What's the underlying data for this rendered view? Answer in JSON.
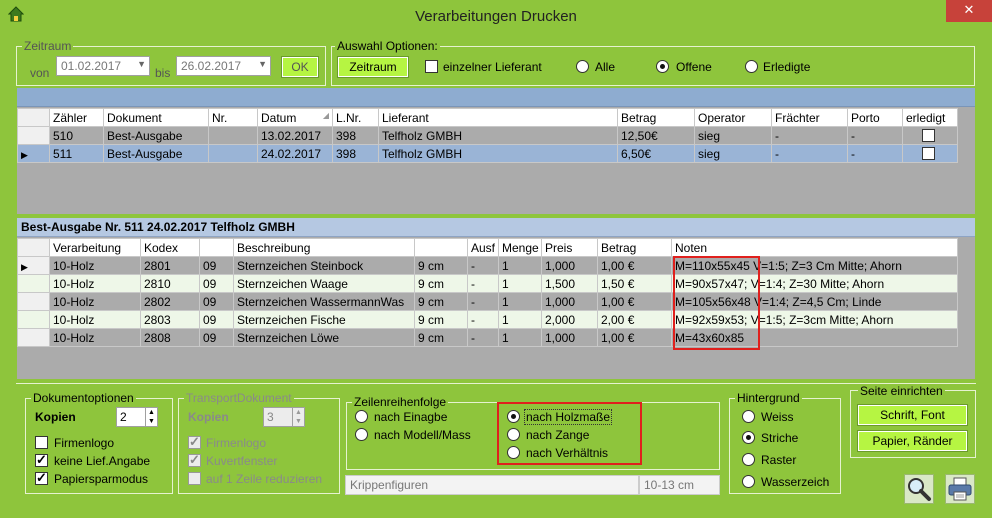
{
  "window": {
    "title": "Verarbeitungen Drucken",
    "close": "✕"
  },
  "zeitraum": {
    "legend": "Zeitraum",
    "von_label": "von",
    "von_value": "01.02.2017",
    "bis_label": "bis",
    "bis_value": "26.02.2017",
    "ok": "OK"
  },
  "auswahl": {
    "legend": "Auswahl Optionen:",
    "zeitraum_button": "Zeitraum",
    "lieferant_label": "einzelner Lieferant",
    "radios": [
      {
        "label": "Alle",
        "selected": false
      },
      {
        "label": "Offene",
        "selected": true
      },
      {
        "label": "Erledigte",
        "selected": false
      }
    ]
  },
  "top_grid": {
    "headers": [
      "Zähler",
      "Dokument",
      "Nr.",
      "Datum",
      "L.Nr.",
      "Lieferant",
      "Betrag",
      "Operator",
      "Frächter",
      "Porto",
      "erledigt"
    ],
    "rows": [
      {
        "cells": [
          "510",
          "Best-Ausgabe",
          "",
          "13.02.2017",
          "398",
          "Telfholz GMBH",
          "12,50€",
          "sieg",
          "-",
          "-"
        ],
        "done": false
      },
      {
        "cells": [
          "511",
          "Best-Ausgabe",
          "",
          "24.02.2017",
          "398",
          "Telfholz GMBH",
          "6,50€",
          "sieg",
          "-",
          "-"
        ],
        "done": false
      }
    ]
  },
  "detail": {
    "header": "Best-Ausgabe Nr. 511 24.02.2017 Telfholz GMBH",
    "headers": [
      "Verarbeitung",
      "Kodex",
      "",
      "Beschreibung",
      "",
      "Ausf",
      "Menge",
      "Preis",
      "Betrag",
      "Noten"
    ],
    "rows": [
      [
        "10-Holz",
        "2801",
        "09",
        "Sternzeichen Steinbock",
        "9 cm",
        "-",
        "1",
        "1,000",
        "1,00 €",
        "M=110x55x45  V=1:5; Z=3 Cm Mitte; Ahorn"
      ],
      [
        "10-Holz",
        "2810",
        "09",
        "Sternzeichen Waage",
        "9 cm",
        "-",
        "1",
        "1,500",
        "1,50 €",
        "M=90x57x47; V=1:4; Z=30 Mitte; Ahorn"
      ],
      [
        "10-Holz",
        "2802",
        "09",
        "Sternzeichen WassermannWas",
        "9 cm",
        "-",
        "1",
        "1,000",
        "1,00 €",
        "M=105x56x48  V=1:4; Z=4,5 Cm; Linde"
      ],
      [
        "10-Holz",
        "2803",
        "09",
        "Sternzeichen Fische",
        "9 cm",
        "-",
        "1",
        "2,000",
        "2,00 €",
        "M=92x59x53; V=1:5; Z=3cm Mitte; Ahorn"
      ],
      [
        "10-Holz",
        "2808",
        "09",
        "Sternzeichen Löwe",
        "9 cm",
        "-",
        "1",
        "1,000",
        "1,00 €",
        "M=43x60x85"
      ]
    ]
  },
  "dokumentoptionen": {
    "legend": "Dokumentoptionen",
    "kopien_label": "Kopien",
    "kopien_value": "2",
    "checks": [
      {
        "label": "Firmenlogo",
        "checked": false
      },
      {
        "label": "keine Lief.Angabe",
        "checked": true
      },
      {
        "label": "Papiersparmodus",
        "checked": true
      }
    ]
  },
  "transport": {
    "legend": "TransportDokument",
    "kopien_label": "Kopien",
    "kopien_value": "3",
    "checks": [
      {
        "label": "Firmenlogo",
        "checked": true
      },
      {
        "label": "Kuvertfenster",
        "checked": true
      },
      {
        "label": "auf 1 Zeile reduzieren",
        "checked": false
      }
    ]
  },
  "zeilenreihenfolge": {
    "legend": "Zeilenreihenfolge",
    "left": [
      {
        "label": "nach Einagbe",
        "selected": false
      },
      {
        "label": "nach Modell/Mass",
        "selected": false
      }
    ],
    "right": [
      {
        "label": "nach Holzmaße",
        "selected": true
      },
      {
        "label": "nach Zange",
        "selected": false
      },
      {
        "label": "nach Verhältnis",
        "selected": false
      }
    ],
    "field_left": "Krippenfiguren",
    "field_right": "10-13 cm"
  },
  "hintergrund": {
    "legend": "Hintergrund",
    "radios": [
      {
        "label": "Weiss",
        "selected": false
      },
      {
        "label": "Striche",
        "selected": true
      },
      {
        "label": "Raster",
        "selected": false
      },
      {
        "label": "Wasserzeich",
        "selected": false
      }
    ]
  },
  "seite": {
    "legend": "Seite einrichten",
    "font_button": "Schrift, Font",
    "papier_button": "Papier, Ränder"
  },
  "icons": {
    "preview": "magnifier-icon",
    "print": "printer-icon"
  },
  "colors": {
    "background": "#8ec53c",
    "button": "#b6f542",
    "selection": "#9ab4d6",
    "highlight": "#e0201d"
  }
}
